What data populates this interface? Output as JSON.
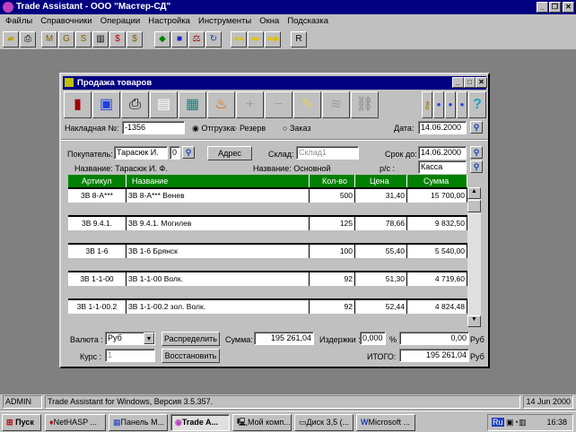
{
  "app": {
    "title": "Trade Assistant - ООО \"Мастер-СД\""
  },
  "menu": [
    "Файлы",
    "Справочники",
    "Операции",
    "Настройка",
    "Инструменты",
    "Окна",
    "Подсказка"
  ],
  "dialog": {
    "title": "Продажа товаров",
    "invoice_label": "Накладная №:",
    "invoice_value": "-1356",
    "radio": [
      {
        "label": "Отгрузка",
        "checked": true
      },
      {
        "label": "Резерв",
        "checked": false
      },
      {
        "label": "Заказ",
        "checked": false
      }
    ],
    "date_label": "Дата:",
    "date_value": "14.06.2000",
    "buyer_label": "Покупатель:",
    "buyer_value": "Тарасюк И.",
    "buyer_code": "0",
    "address_button": "Адрес",
    "warehouse_label": "Склад:",
    "warehouse_value": "Склад1",
    "due_label": "Срок до:",
    "due_value": "14.06.2000",
    "buyer_name": "Название: Тарасюк И. Ф.",
    "warehouse_name": "Название: Основной",
    "account_label": "р/с :",
    "account_value": "Касса",
    "columns": [
      "Артикул",
      "Название",
      "Кол-во",
      "Цена",
      "Сумма"
    ],
    "rows": [
      [
        "3В 8-А***",
        "3В 8-А***   Венев",
        "500",
        "31,40",
        "15 700,00"
      ],
      [
        "3В 9.4.1.",
        "3В 9.4.1. Могилев",
        "125",
        "78,66",
        "9 832,50"
      ],
      [
        "3В 1-6",
        "3В 1-6    Брянск",
        "100",
        "55,40",
        "5 540,00"
      ],
      [
        "3В 1-1-00",
        "3В 1-1-00  Волк.",
        "92",
        "51,30",
        "4 719,60"
      ],
      [
        "3В 1-1-00.2",
        "3В 1-1-00.2 зол. Волк.",
        "92",
        "52,44",
        "4 824,48"
      ]
    ],
    "currency_label": "Валюта :",
    "currency_value": "Руб",
    "distribute_button": "Распределить",
    "sum_label": "Сумма:",
    "sum_value": "195 261,04",
    "costs_label": "Издержки :",
    "costs_value": "0,000",
    "percent": "%",
    "costs_amount": "0,00",
    "rub": "Руб",
    "rate_label": "Курс :",
    "rate_value": "1",
    "restore_button": "Восстановить",
    "total_label": "ИТОГО:",
    "total_value": "195 261,04"
  },
  "status": {
    "user": "ADMIN",
    "message": "Trade Assistant for Windows, Версия 3.5.357.",
    "date": "14 Jun 2000"
  },
  "taskbar": {
    "start": "Пуск",
    "tasks": [
      "NetHASP ...",
      "Панель М...",
      "Trade A...",
      "Мой комп...",
      "Диск 3,5 (...",
      "Microsoft ..."
    ],
    "lang": "Ru",
    "clock": "16:38"
  }
}
